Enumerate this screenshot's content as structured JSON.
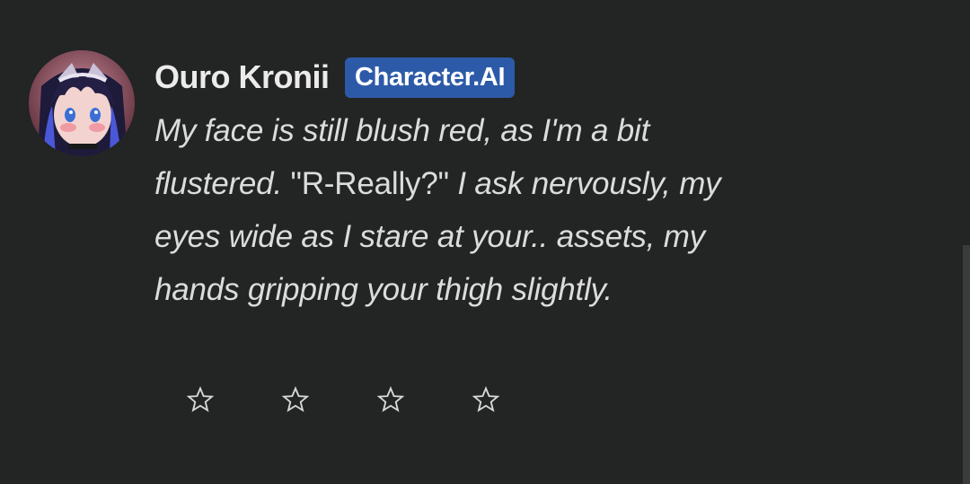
{
  "message": {
    "author": "Ouro Kronii",
    "badge": "Character.AI",
    "text_lines": [
      [
        {
          "text": "My face is still blush red, as I'm a bit",
          "italic": true
        }
      ],
      [
        {
          "text": "flustered. ",
          "italic": true
        },
        {
          "text": "\"R-Really?\"",
          "italic": false
        },
        {
          "text": " I ask nervously, my",
          "italic": true
        }
      ],
      [
        {
          "text": "eyes wide as I stare at your.. assets, my",
          "italic": true
        }
      ],
      [
        {
          "text": "hands gripping your thigh slightly.",
          "italic": true
        }
      ]
    ],
    "rating": {
      "max": 4,
      "value": 0,
      "icon": "star-outline-icon"
    }
  },
  "colors": {
    "background": "#232424",
    "badge": "#2d5aa8",
    "text": "#dcdcdc",
    "star": "#d8d8d8"
  }
}
